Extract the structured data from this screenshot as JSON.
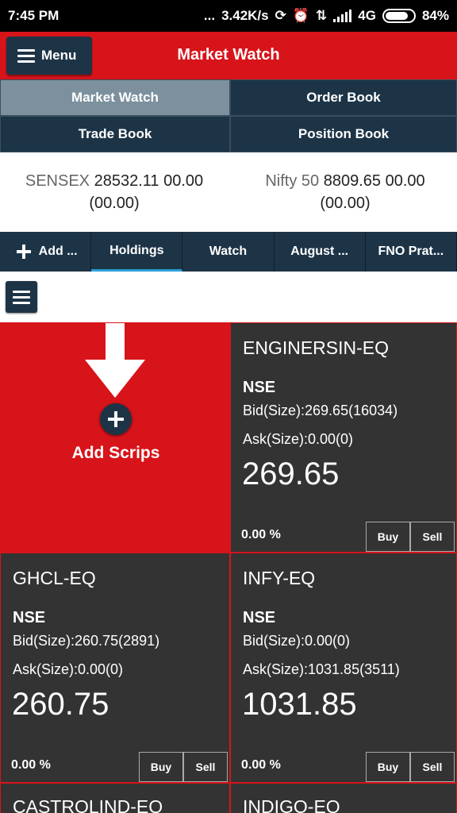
{
  "status_bar": {
    "time": "7:45 PM",
    "dots": "...",
    "speed": "3.42K/s",
    "network": "4G",
    "battery": "84%"
  },
  "header": {
    "menu_label": "Menu",
    "title": "Market Watch"
  },
  "nav": {
    "items": [
      {
        "label": "Market Watch"
      },
      {
        "label": "Order Book"
      },
      {
        "label": "Trade Book"
      },
      {
        "label": "Position Book"
      }
    ]
  },
  "indices": [
    {
      "name": "SENSEX",
      "value": "28532.11 00.00",
      "change": "(00.00)"
    },
    {
      "name": "Nifty 50",
      "value": "8809.65 00.00",
      "change": "(00.00)"
    }
  ],
  "tabs": [
    {
      "label": "Add ..."
    },
    {
      "label": "Holdings"
    },
    {
      "label": "Watch"
    },
    {
      "label": "August ..."
    },
    {
      "label": "FNO Prat..."
    }
  ],
  "add_scrips_label": "Add Scrips",
  "scrips": [
    {
      "title": "ENGINERSIN-EQ",
      "exchange": "NSE",
      "bid": "Bid(Size):269.65(16034)",
      "ask": "Ask(Size):0.00(0)",
      "price": "269.65",
      "change": "0.00 %",
      "buy": "Buy",
      "sell": "Sell"
    },
    {
      "title": "GHCL-EQ",
      "exchange": "NSE",
      "bid": "Bid(Size):260.75(2891)",
      "ask": "Ask(Size):0.00(0)",
      "price": "260.75",
      "change": "0.00 %",
      "buy": "Buy",
      "sell": "Sell"
    },
    {
      "title": "INFY-EQ",
      "exchange": "NSE",
      "bid": "Bid(Size):0.00(0)",
      "ask": "Ask(Size):1031.85(3511)",
      "price": "1031.85",
      "change": "0.00 %",
      "buy": "Buy",
      "sell": "Sell"
    },
    {
      "title": "CASTROLIND-EQ"
    },
    {
      "title": "INDIGO-EQ"
    }
  ],
  "colors": {
    "brand_red": "#d7141a",
    "navy": "#1d3447",
    "card_dark": "#333333",
    "active_tab_underline": "#2b9fd8"
  }
}
